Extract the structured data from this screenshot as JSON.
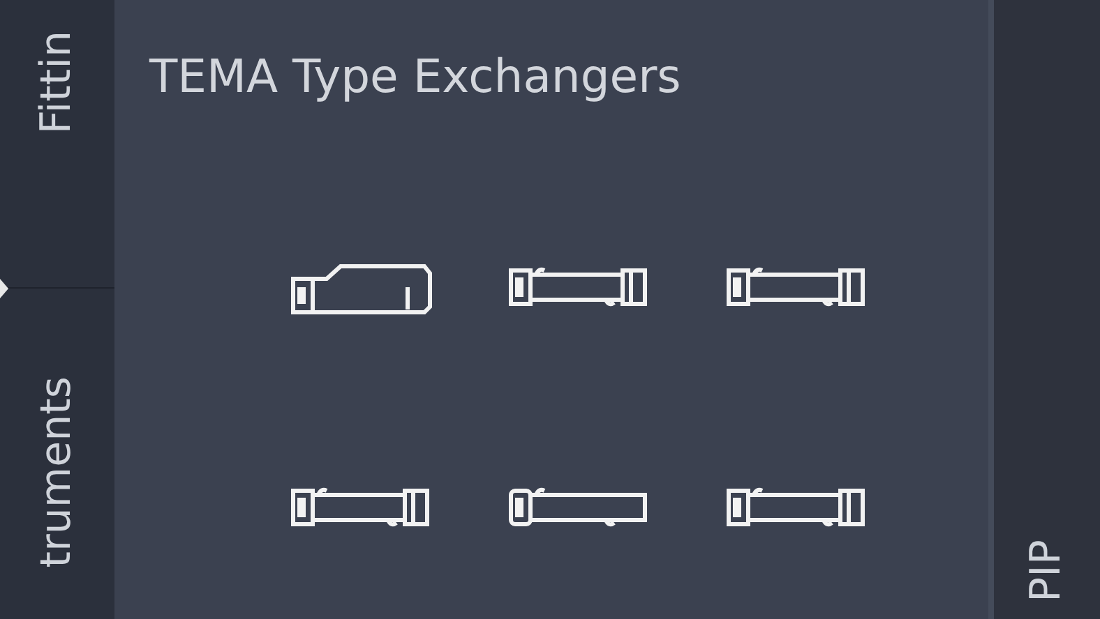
{
  "left_tabs": [
    {
      "label": "Fittin"
    },
    {
      "label": "truments"
    }
  ],
  "palette": {
    "title": "TEMA Type Exchangers",
    "tools": [
      {
        "kind": "kettle"
      },
      {
        "kind": "flanged"
      },
      {
        "kind": "flanged"
      },
      {
        "kind": "flanged"
      },
      {
        "kind": "rounded"
      },
      {
        "kind": "flanged"
      }
    ]
  },
  "right_tab": {
    "label": "PIP"
  }
}
